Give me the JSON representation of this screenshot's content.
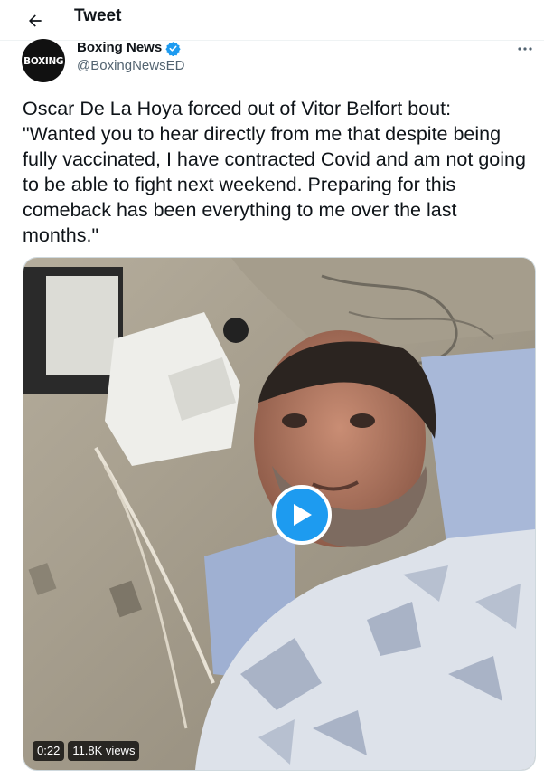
{
  "header": {
    "title": "Tweet",
    "back_icon": "arrow-left-icon"
  },
  "author": {
    "name": "Boxing News",
    "handle": "@BoxingNewsED",
    "avatar_text": "BOXING",
    "verified": true,
    "verified_color": "#1d9bf0"
  },
  "tweet": {
    "text": "Oscar De La Hoya forced out of Vitor Belfort bout:\n\"Wanted you to hear directly from me that despite being fully vaccinated, I have contracted Covid and am not going to be able to fight next weekend. Preparing for this comeback has been everything to me over the last months.\""
  },
  "media": {
    "type": "video",
    "duration": "0:22",
    "views": "11.8K views",
    "play_color": "#1d9bf0"
  },
  "colors": {
    "accent": "#1d9bf0",
    "text": "#0f1419",
    "secondary": "#536471"
  }
}
